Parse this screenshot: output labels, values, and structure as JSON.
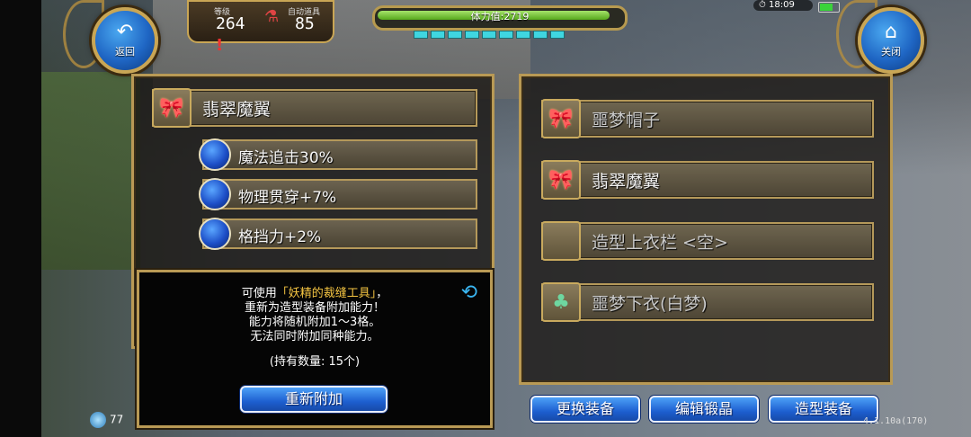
{
  "top_bar": {
    "back_label": "返回",
    "close_label": "关闭",
    "level_label": "等级",
    "level_value": "264",
    "auto_potion_label": "自动道具",
    "auto_potion_value": "85",
    "warning_mark": "!",
    "hp_label": "体力值:2719",
    "hp_fraction": 0.97,
    "time": "18:09"
  },
  "left_panel": {
    "item_name": "翡翠魔翼",
    "attributes": [
      {
        "text": "魔法追击30%"
      },
      {
        "text": "物理贯穿+7%"
      },
      {
        "text": "格挡力+2%"
      }
    ]
  },
  "info": {
    "line1_prefix": "可使用",
    "line1_item": "「妖精的裁缝工具」",
    "line1_suffix": "，",
    "line2": "重新为造型装备附加能力！",
    "line3": "能力将随机附加1～3格。",
    "line4": "无法同时附加同种能力。",
    "count_text": "(持有数量: 15个)",
    "reattach_label": "重新附加"
  },
  "right_panel": {
    "slots": [
      {
        "name": "噩梦帽子",
        "icon": "bow-icon",
        "dim": true
      },
      {
        "name": "翡翠魔翼",
        "icon": "bow-icon",
        "dim": false
      },
      {
        "name": "造型上衣栏 <空>",
        "icon": "empty",
        "dim": true
      },
      {
        "name": "噩梦下衣(白梦)",
        "icon": "armor-icon",
        "dim": true
      }
    ]
  },
  "bottom_buttons": {
    "change_label": "更换装备",
    "edit_label": "编辑锻晶",
    "style_label": "造型装备"
  },
  "footer": {
    "version": "4.1.10a(170)",
    "bottom_left_value": "77"
  },
  "colors": {
    "gold_border": "#b99a55",
    "button_blue": "#1d5fd0",
    "highlight_yellow": "#f5c542",
    "hp_green": "#57a81c"
  }
}
